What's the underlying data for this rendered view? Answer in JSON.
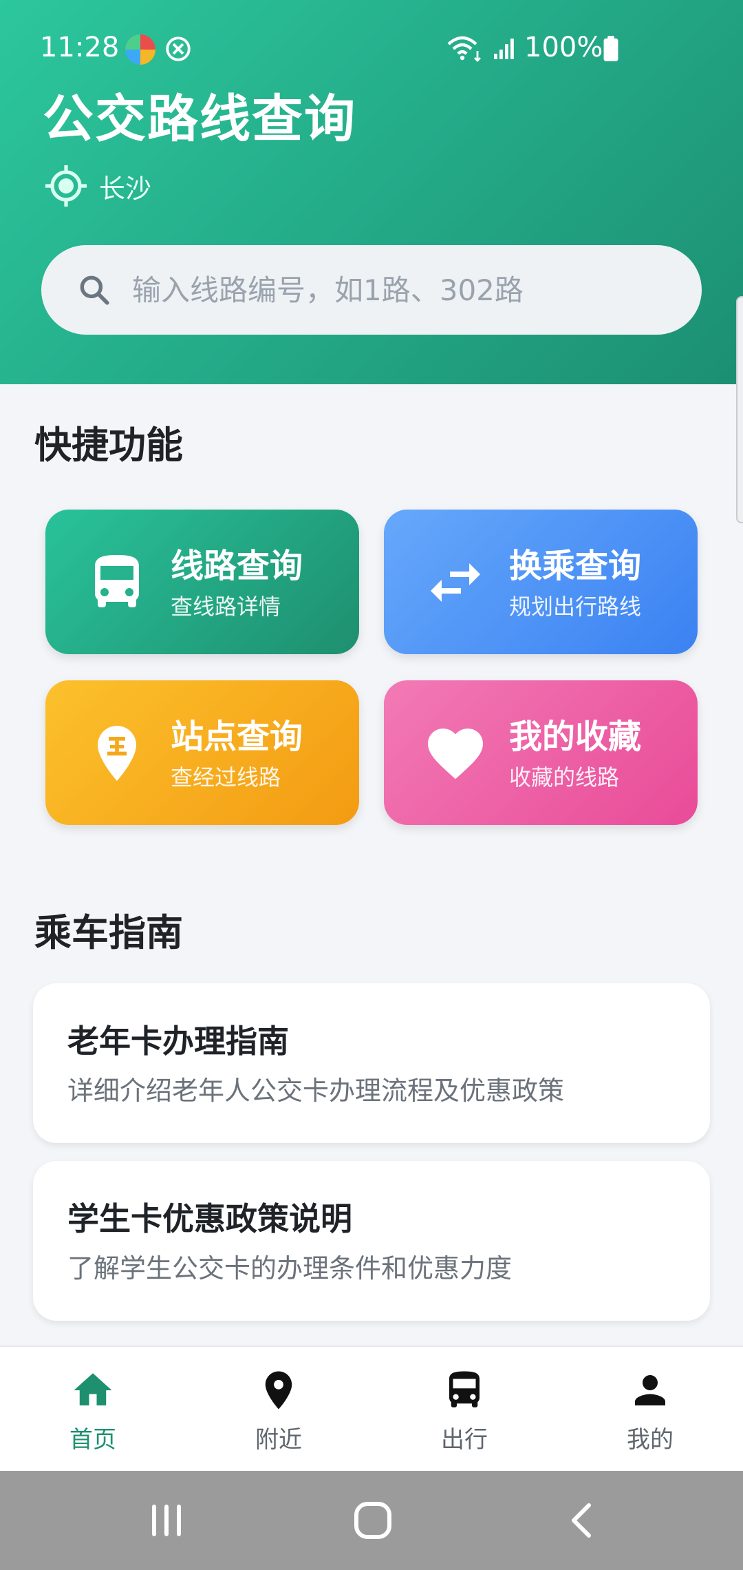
{
  "status_bar": {
    "time": "11:28",
    "battery": "100%",
    "icons": [
      "browser-app-icon",
      "no-ads-icon",
      "wifi-icon",
      "signal-icon",
      "battery-icon"
    ]
  },
  "header": {
    "title": "公交路线查询",
    "city": "长沙",
    "location_icon": "gps-target-icon"
  },
  "search": {
    "placeholder": "输入线路编号，如1路、302路",
    "value": ""
  },
  "quick_actions": {
    "title": "快捷功能",
    "tiles": [
      {
        "title": "线路查询",
        "subtitle": "查线路详情",
        "icon": "bus-icon",
        "color": "#23a886"
      },
      {
        "title": "换乘查询",
        "subtitle": "规划出行路线",
        "icon": "swap-arrows-icon",
        "color": "#4b8ff5"
      },
      {
        "title": "站点查询",
        "subtitle": "查经过线路",
        "icon": "bus-stop-pin-icon",
        "color": "#f7ac1c"
      },
      {
        "title": "我的收藏",
        "subtitle": "收藏的线路",
        "icon": "heart-icon",
        "color": "#ee5ea5"
      }
    ]
  },
  "guide": {
    "title": "乘车指南",
    "items": [
      {
        "title": "老年卡办理指南",
        "desc": "详细介绍老年人公交卡办理流程及优惠政策"
      },
      {
        "title": "学生卡优惠政策说明",
        "desc": "了解学生公交卡的办理条件和优惠力度"
      }
    ]
  },
  "bottom_nav": {
    "items": [
      {
        "label": "首页",
        "icon": "home-icon",
        "active": true
      },
      {
        "label": "附近",
        "icon": "location-pin-icon",
        "active": false
      },
      {
        "label": "出行",
        "icon": "bus-icon",
        "active": false
      },
      {
        "label": "我的",
        "icon": "person-icon",
        "active": false
      }
    ],
    "active_color": "#1e8f6f"
  },
  "colors": {
    "header_start": "#2cc79d",
    "header_end": "#1c8f72",
    "page_bg": "#f4f5f8"
  }
}
